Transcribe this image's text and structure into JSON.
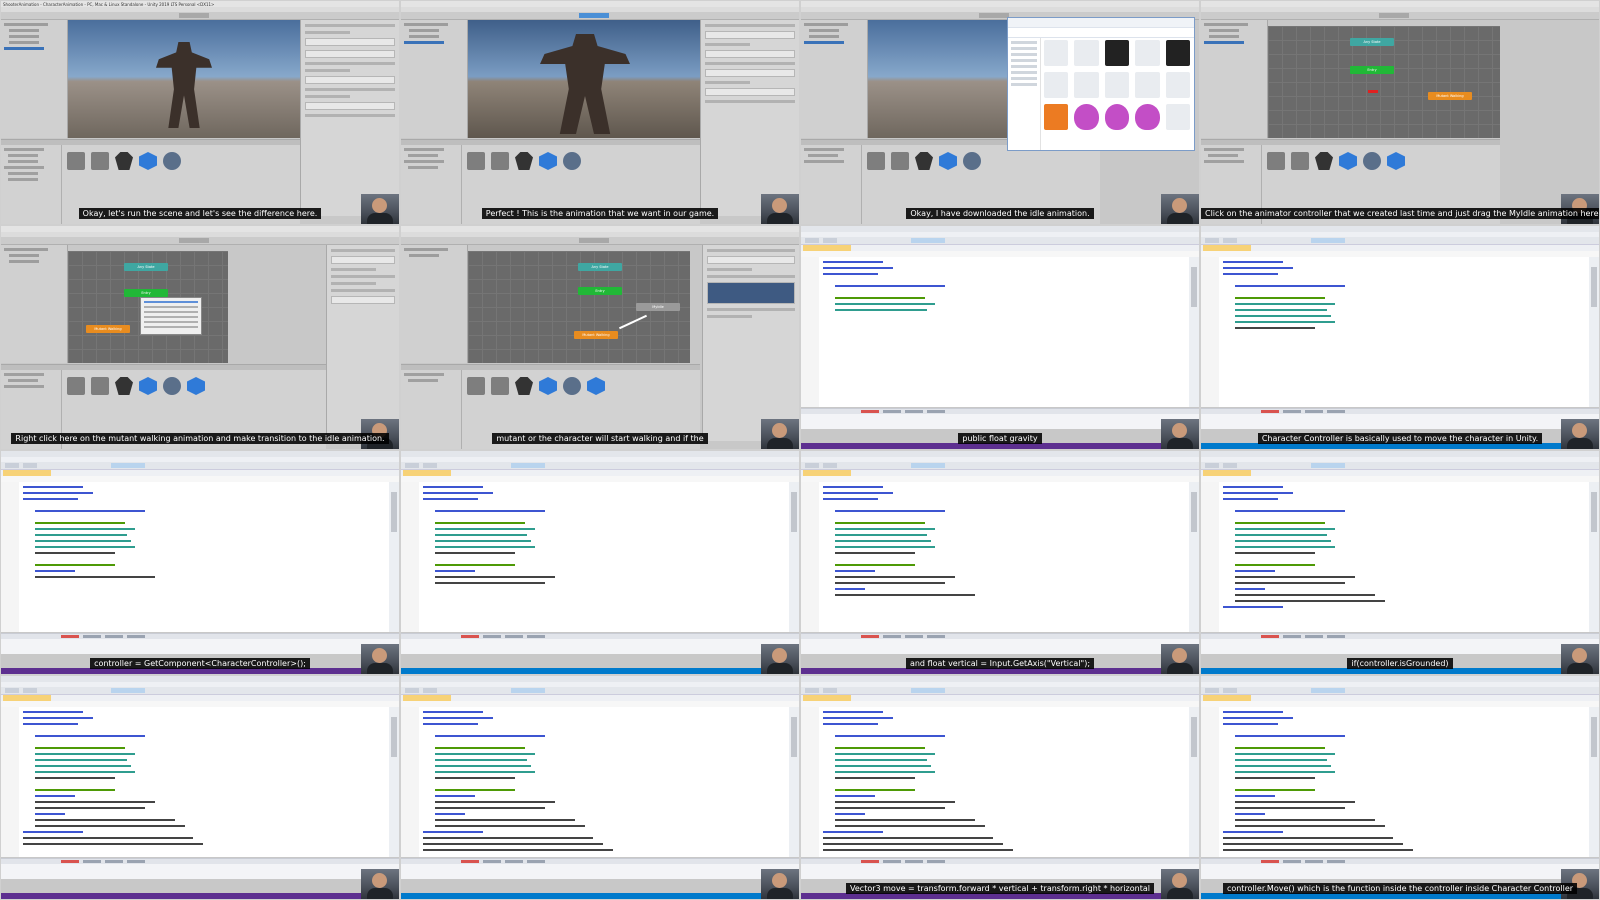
{
  "window": {
    "unity_title": "ShooterAnimation - CharacterAnimation - PC, Mac & Linux Standalone - Unity 2019 LTS Personal <DX11>"
  },
  "frames": [
    {
      "id": "f1",
      "kind": "unity-scene",
      "caption": "Okay, let's run the scene and let's see the difference here."
    },
    {
      "id": "f2",
      "kind": "unity-scene-play",
      "caption": "Perfect ! This is the animation that we want in our game."
    },
    {
      "id": "f3",
      "kind": "unity-explorer",
      "caption": "Okay, I have downloaded the idle animation."
    },
    {
      "id": "f4",
      "kind": "unity-animator",
      "caption": "Click on the animator controller that we created last time and just drag the MyIdle animation here."
    },
    {
      "id": "f5",
      "kind": "unity-animator-menu",
      "caption": "Right click here on the mutant walking animation and make transition to the idle animation."
    },
    {
      "id": "f6",
      "kind": "unity-animator-transition",
      "caption": "mutant or the character will start walking and if the"
    },
    {
      "id": "f7",
      "kind": "vs-code",
      "caption": "public float gravity"
    },
    {
      "id": "f8",
      "kind": "vs-code",
      "caption": "Character Controller is basically used to move the character in Unity."
    },
    {
      "id": "f9",
      "kind": "vs-code",
      "caption": "controller = GetComponent<CharacterController>();"
    },
    {
      "id": "f10",
      "kind": "vs-code",
      "caption": ""
    },
    {
      "id": "f11",
      "kind": "vs-code",
      "caption": "and float vertical = Input.GetAxis(\"Vertical\");"
    },
    {
      "id": "f12",
      "kind": "vs-code",
      "caption": "if(controller.isGrounded)"
    },
    {
      "id": "f13",
      "kind": "vs-code",
      "caption": ""
    },
    {
      "id": "f14",
      "kind": "vs-code",
      "caption": ""
    },
    {
      "id": "f15",
      "kind": "vs-code",
      "caption": "Vector3 move = transform.forward * vertical + transform.right * horizontal"
    },
    {
      "id": "f16",
      "kind": "vs-code",
      "caption": "controller.Move() which is the function inside the controller inside Character Controller"
    }
  ],
  "animator_states": {
    "any": "Any State",
    "entry": "Entry",
    "walk": "Mutant Walking",
    "idle": "MyIdle"
  },
  "colors": {
    "caption_bg": "#000000",
    "caption_fg": "#ffffff",
    "unity_play": "#4a8fd6",
    "node_entry": "#21b837",
    "node_state": "#e88c1f",
    "node_any": "#3fa7a2",
    "vs_status": "#5d2f90"
  }
}
